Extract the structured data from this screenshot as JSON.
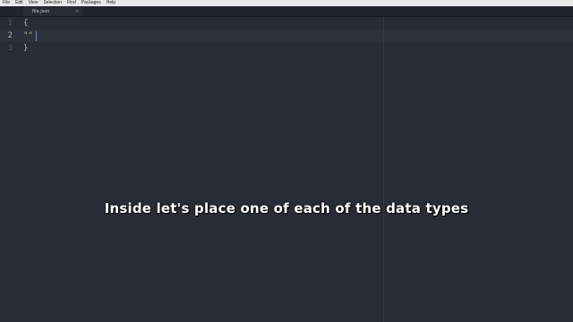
{
  "menubar": {
    "items": [
      "File",
      "Edit",
      "View",
      "Selection",
      "Find",
      "Packages",
      "Help"
    ]
  },
  "tabs": [
    {
      "label": "file.json",
      "close_icon": "×"
    }
  ],
  "editor": {
    "lines": [
      {
        "number": "1",
        "code": "{"
      },
      {
        "number": "2",
        "code": "\"\""
      },
      {
        "number": "3",
        "code": "}"
      }
    ],
    "active_line": 2
  },
  "caption": {
    "text": "Inside let's place one of each of the data types"
  },
  "colors": {
    "background": "#282c34",
    "menubar": "#e8e8e8",
    "string": "#98c379",
    "cursor": "#528bff"
  }
}
